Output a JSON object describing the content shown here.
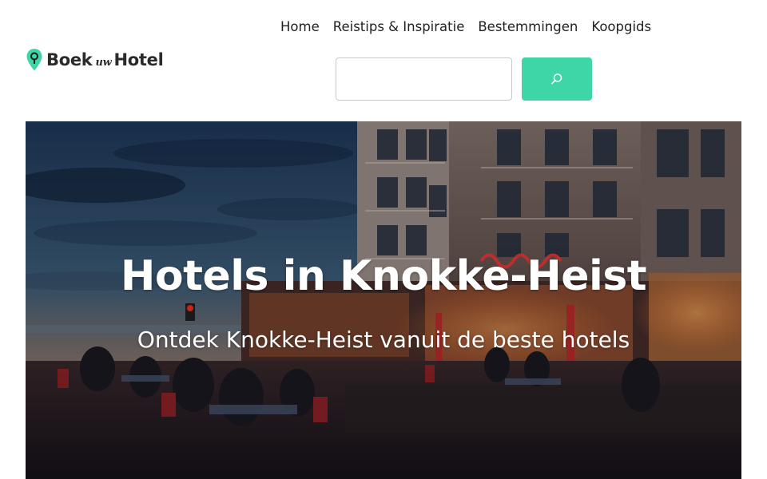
{
  "site": {
    "logo_word_1": "Boek",
    "logo_word_2": "uw",
    "logo_word_3": "Hotel",
    "logo_icon": "map-pin-icon",
    "brand_color": "#3ed6a6"
  },
  "nav": {
    "items": [
      {
        "label": "Home"
      },
      {
        "label": "Reistips & Inspiratie"
      },
      {
        "label": "Bestemmingen"
      },
      {
        "label": "Koopgids"
      }
    ]
  },
  "search": {
    "value": "",
    "placeholder": "",
    "button_icon": "search-icon"
  },
  "hero": {
    "title": "Hotels in Knokke-Heist",
    "subtitle": "Ontdek Knokke-Heist vanuit de beste hotels",
    "image": "evening-seafront-terrace-photo"
  }
}
